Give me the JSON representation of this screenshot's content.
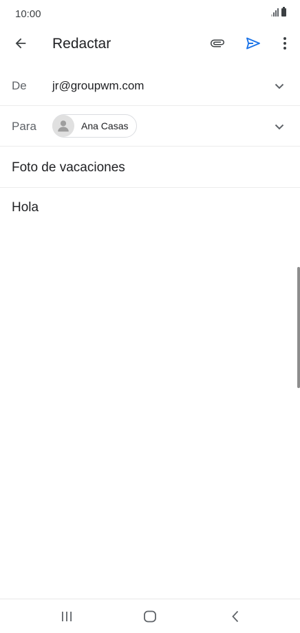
{
  "status_bar": {
    "time": "10:00",
    "icons": [
      "signal-icon",
      "battery-icon"
    ]
  },
  "app_bar": {
    "title": "Redactar",
    "icons": [
      "back-arrow-icon",
      "paperclip-icon",
      "send-icon",
      "more-vert-icon"
    ],
    "send_color": "#1a73e8"
  },
  "compose": {
    "from": {
      "label": "De",
      "value": "jr@groupwm.com"
    },
    "to": {
      "label": "Para",
      "recipient": "Ana Casas"
    },
    "subject": "Foto de vacaciones",
    "body": "Hola"
  },
  "nav_bar": {
    "icons": [
      "recents-icon",
      "home-icon",
      "back-icon"
    ]
  }
}
